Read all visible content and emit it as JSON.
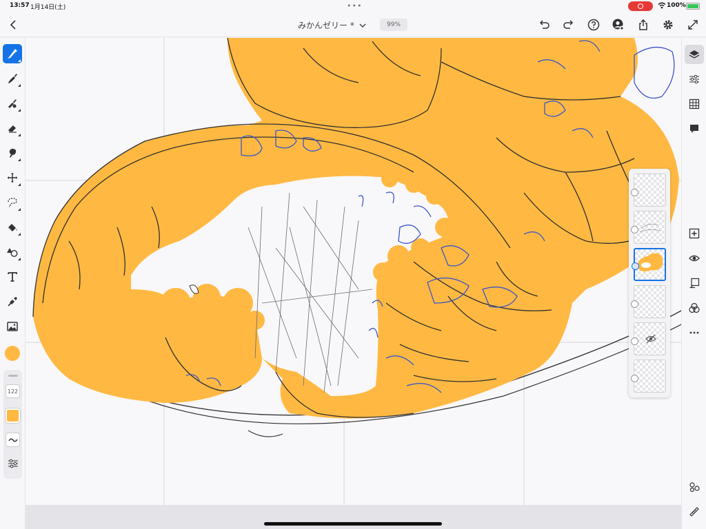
{
  "status": {
    "time": "13:57",
    "date": "1月14日(土)",
    "dots": "•••",
    "battery": "100%"
  },
  "header": {
    "title": "みかんゼリー *",
    "zoom": "99%"
  },
  "left_tools": [
    {
      "name": "pixel-brush-tool-icon",
      "active": true
    },
    {
      "name": "live-brush-tool-icon",
      "active": false
    },
    {
      "name": "vector-brush-tool-icon",
      "active": false
    },
    {
      "name": "eraser-tool-icon",
      "active": false
    },
    {
      "name": "smudge-tool-icon",
      "active": false
    },
    {
      "name": "move-tool-icon",
      "active": false
    },
    {
      "name": "lasso-select-tool-icon",
      "active": false
    },
    {
      "name": "fill-tool-icon",
      "active": false
    },
    {
      "name": "shapes-tool-icon",
      "active": false
    },
    {
      "name": "text-tool-icon",
      "active": false
    },
    {
      "name": "eyedropper-tool-icon",
      "active": false
    },
    {
      "name": "image-tool-icon",
      "active": false
    }
  ],
  "brush": {
    "size": "122",
    "color": "#ffb942"
  },
  "layers": [
    {
      "name": "layer-1",
      "selected": false,
      "hidden": false
    },
    {
      "name": "layer-2",
      "selected": false,
      "hidden": false
    },
    {
      "name": "layer-3",
      "selected": true,
      "hidden": false
    },
    {
      "name": "layer-4",
      "selected": false,
      "hidden": false
    },
    {
      "name": "layer-5",
      "selected": false,
      "hidden": true
    },
    {
      "name": "layer-6",
      "selected": false,
      "hidden": false
    }
  ],
  "colors": {
    "accent": "#1473e6",
    "fill": "#ffb942",
    "line": "#2f2f2f",
    "blue_line": "#3b55c8"
  }
}
